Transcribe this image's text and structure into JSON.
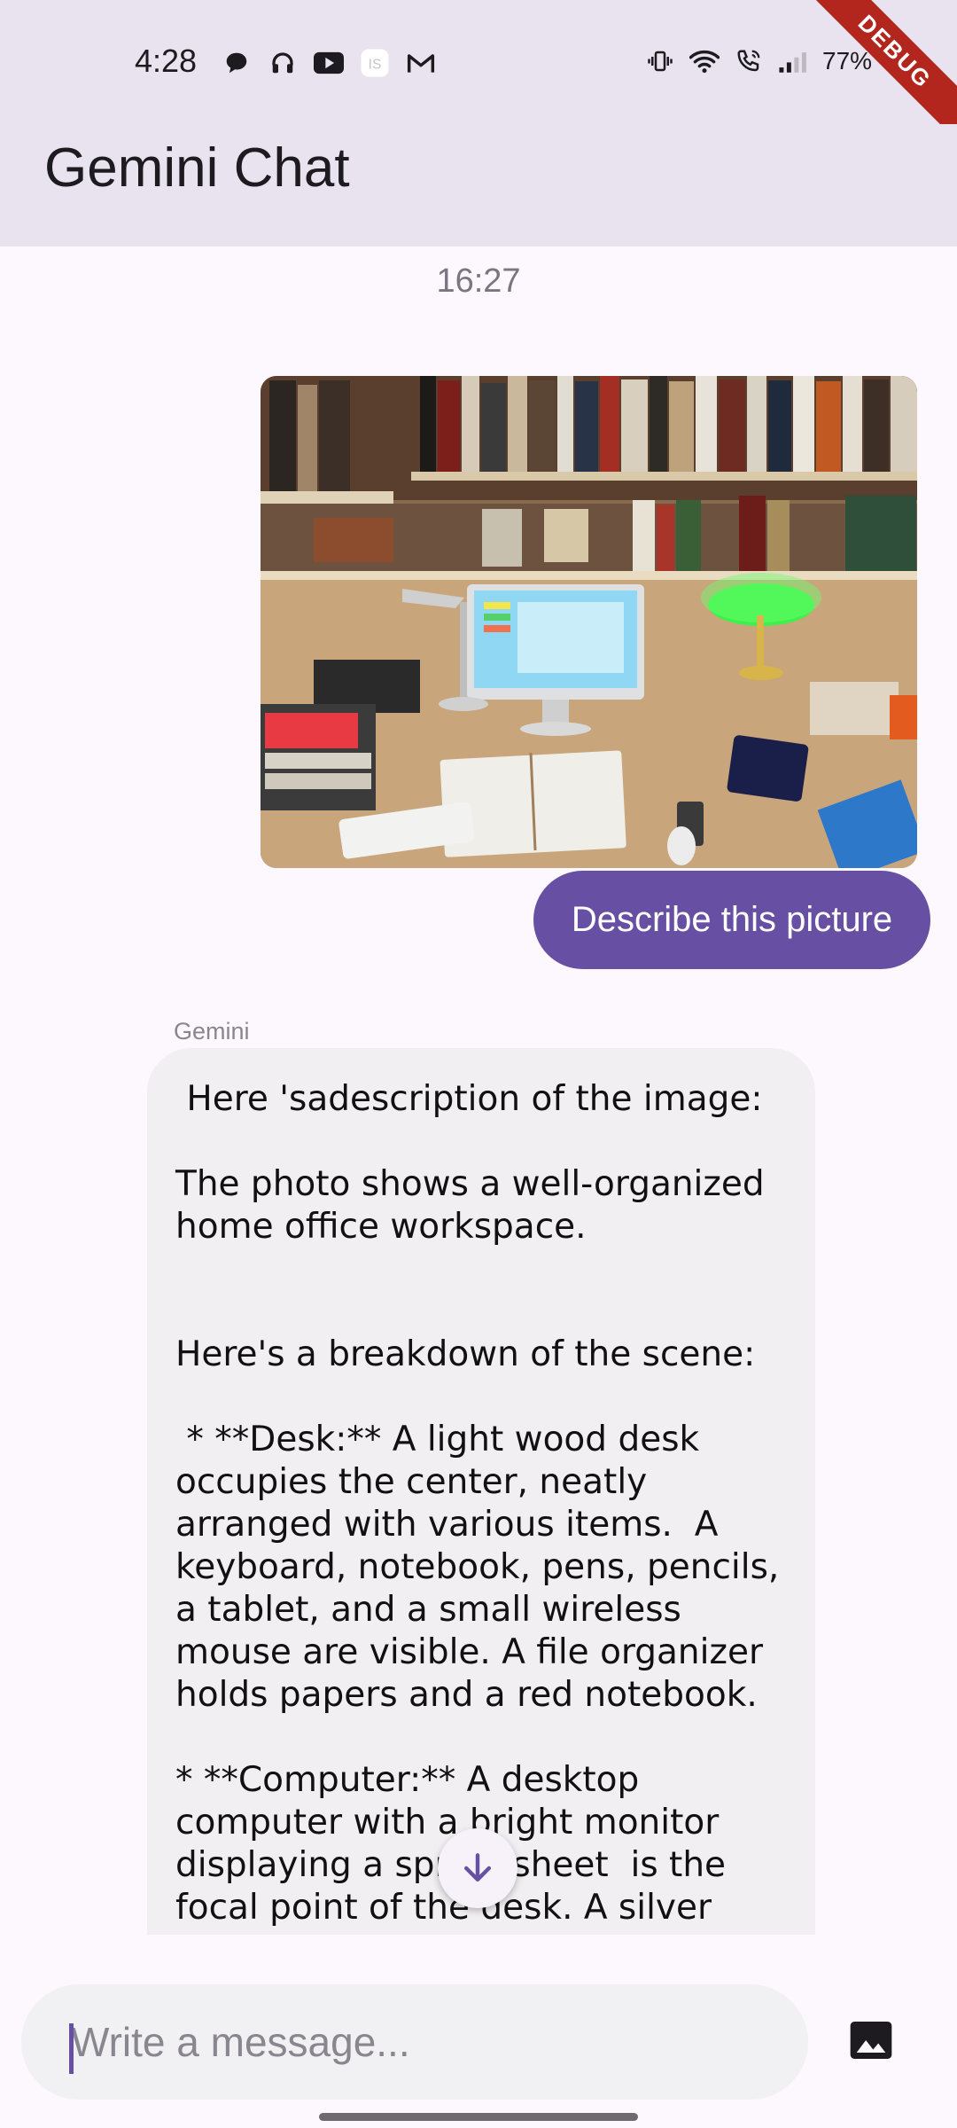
{
  "status_bar": {
    "time": "4:28",
    "battery": "77%"
  },
  "debug_banner": "DEBUG",
  "app_bar": {
    "title": "Gemini Chat"
  },
  "chat": {
    "timestamp": "16:27",
    "user_message": {
      "text": "Describe this picture"
    },
    "bot_message": {
      "sender": "Gemini",
      "text": " Here 'sadescription of the image:\n\nThe photo shows a well-organized home office workspace.\n\n\nHere's a breakdown of the scene:\n\n * **Desk:** A light wood desk occupies the center, neatly arranged with various items.  A keyboard, notebook, pens, pencils, a tablet, and a small wireless mouse are visible. A file organizer holds papers and a red notebook.\n\n* **Computer:** A desktop computer with a bright monitor displaying a spreadsheet  is the focal point of the desk. A silver desk lamp illuminates the"
    }
  },
  "composer": {
    "placeholder": "Write a message..."
  },
  "colors": {
    "primary": "#6750a4",
    "app_bar": "#e8e3ee",
    "background": "#fdf7fe",
    "bot_bubble": "#f1eff2"
  },
  "icons": {
    "scroll_down": "arrow-down-icon",
    "attach_image": "image-icon"
  }
}
